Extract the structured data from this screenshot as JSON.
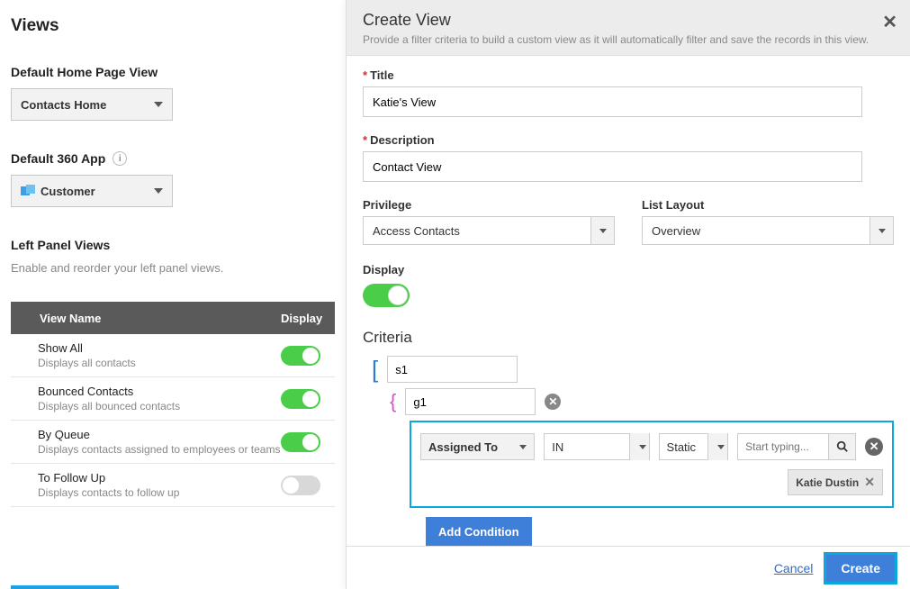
{
  "left": {
    "page_title": "Views",
    "default_home_heading": "Default Home Page View",
    "default_home_select": "Contacts Home",
    "default_360_heading": "Default 360 App",
    "default_360_select": "Customer",
    "left_panel_heading": "Left Panel Views",
    "left_panel_sub": "Enable and reorder your left panel views.",
    "table": {
      "col_name": "View Name",
      "col_display": "Display"
    },
    "views": [
      {
        "title": "Show All",
        "desc": "Displays all contacts",
        "on": true
      },
      {
        "title": "Bounced Contacts",
        "desc": "Displays all bounced contacts",
        "on": true
      },
      {
        "title": "By Queue",
        "desc": "Displays contacts assigned to employees or teams",
        "on": true
      },
      {
        "title": "To Follow Up",
        "desc": "Displays contacts to follow up",
        "on": false
      }
    ]
  },
  "modal": {
    "title": "Create View",
    "subtitle": "Provide a filter criteria to build a custom view as it will automatically filter and save the records in this view.",
    "form": {
      "title_label": "Title",
      "title_value": "Katie's View",
      "desc_label": "Description",
      "desc_value": "Contact View",
      "priv_label": "Privilege",
      "priv_value": "Access Contacts",
      "layout_label": "List Layout",
      "layout_value": "Overview",
      "display_label": "Display"
    },
    "criteria": {
      "heading": "Criteria",
      "s1": "s1",
      "g1": "g1",
      "field": "Assigned To",
      "op": "IN",
      "type": "Static",
      "search_placeholder": "Start typing...",
      "chip": "Katie Dustin",
      "add_condition": "Add Condition"
    },
    "footer": {
      "cancel": "Cancel",
      "create": "Create"
    }
  }
}
